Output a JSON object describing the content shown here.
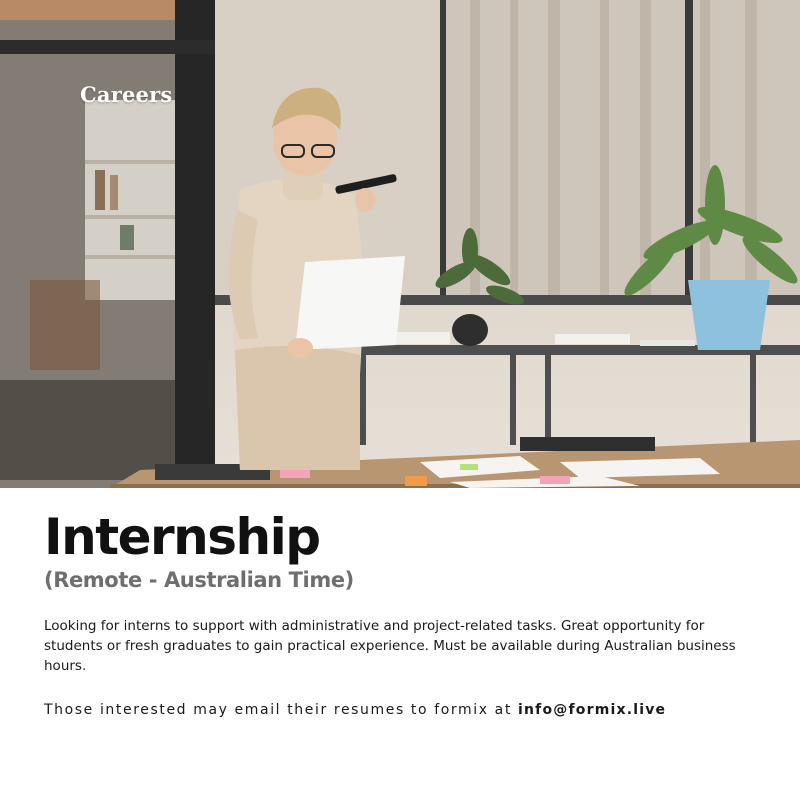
{
  "header": {
    "label": "Careers"
  },
  "photo": {
    "description_icon": "photo-woman-phone-office"
  },
  "job": {
    "title": "Internship",
    "subtitle": "(Remote - Australian Time)",
    "description": "Looking for interns to support with administrative and project-related tasks. Great opportunity for students or fresh graduates to gain practical experience. Must be available during Australian business hours.",
    "contact_text": "Those interested may email their resumes to formix at ",
    "email": "info@formix.live"
  },
  "colors": {
    "title": "#111111",
    "subtitle": "#6e6e6e",
    "body": "#1a1a1a",
    "careers_label": "#ffffff"
  }
}
